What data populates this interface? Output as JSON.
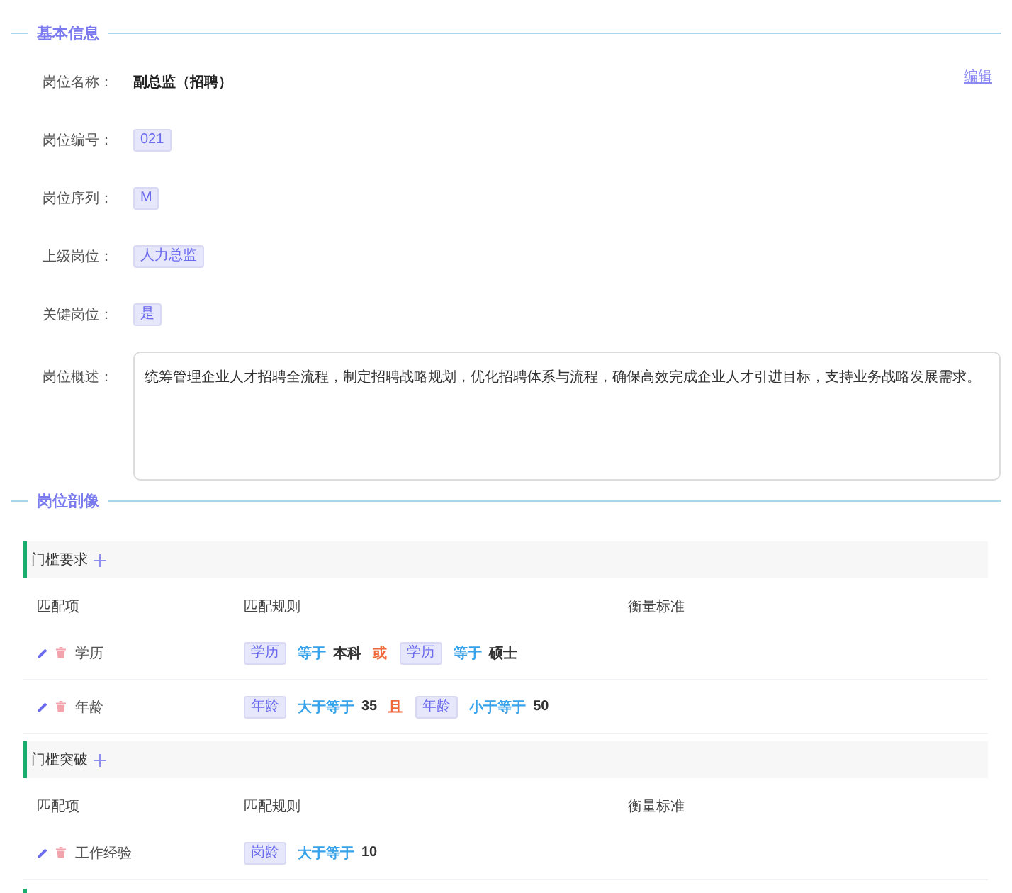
{
  "basic_info": {
    "title": "基本信息",
    "edit_link": "编辑",
    "fields": [
      {
        "label": "岗位名称：",
        "kind": "text",
        "value": "副总监（招聘）"
      },
      {
        "label": "岗位编号：",
        "kind": "tag",
        "value": "021"
      },
      {
        "label": "岗位序列：",
        "kind": "tag",
        "value": "M"
      },
      {
        "label": "上级岗位：",
        "kind": "tag",
        "value": "人力总监"
      },
      {
        "label": "关键岗位：",
        "kind": "tag",
        "value": "是"
      },
      {
        "label": "岗位概述：",
        "kind": "textarea",
        "value": "统筹管理企业人才招聘全流程，制定招聘战略规划，优化招聘体系与流程，确保高效完成企业人才引进目标，支持业务战略发展需求。"
      }
    ]
  },
  "profile": {
    "title": "岗位剖像",
    "groups": [
      {
        "title": "门槛要求",
        "columns": [
          "匹配项",
          "匹配规则",
          "衡量标准"
        ],
        "rows": [
          {
            "item": "学历",
            "rule": [
              {
                "kind": "tag",
                "text": "学历"
              },
              {
                "kind": "operator",
                "text": "等于"
              },
              {
                "kind": "value",
                "text": "本科"
              },
              {
                "kind": "connector",
                "text": "或"
              },
              {
                "kind": "tag",
                "text": "学历"
              },
              {
                "kind": "operator",
                "text": "等于"
              },
              {
                "kind": "value",
                "text": "硕士"
              }
            ]
          },
          {
            "item": "年龄",
            "rule": [
              {
                "kind": "tag",
                "text": "年龄"
              },
              {
                "kind": "operator",
                "text": "大于等于"
              },
              {
                "kind": "value",
                "text": "35"
              },
              {
                "kind": "connector",
                "text": "且"
              },
              {
                "kind": "tag",
                "text": "年龄"
              },
              {
                "kind": "operator",
                "text": "小于等于"
              },
              {
                "kind": "value",
                "text": "50"
              }
            ]
          }
        ]
      },
      {
        "title": "门槛突破",
        "columns": [
          "匹配项",
          "匹配规则",
          "衡量标准"
        ],
        "rows": [
          {
            "item": "工作经验",
            "rule": [
              {
                "kind": "tag",
                "text": "岗龄"
              },
              {
                "kind": "operator",
                "text": "大于等于"
              },
              {
                "kind": "value",
                "text": "10"
              }
            ]
          }
        ]
      }
    ]
  }
}
